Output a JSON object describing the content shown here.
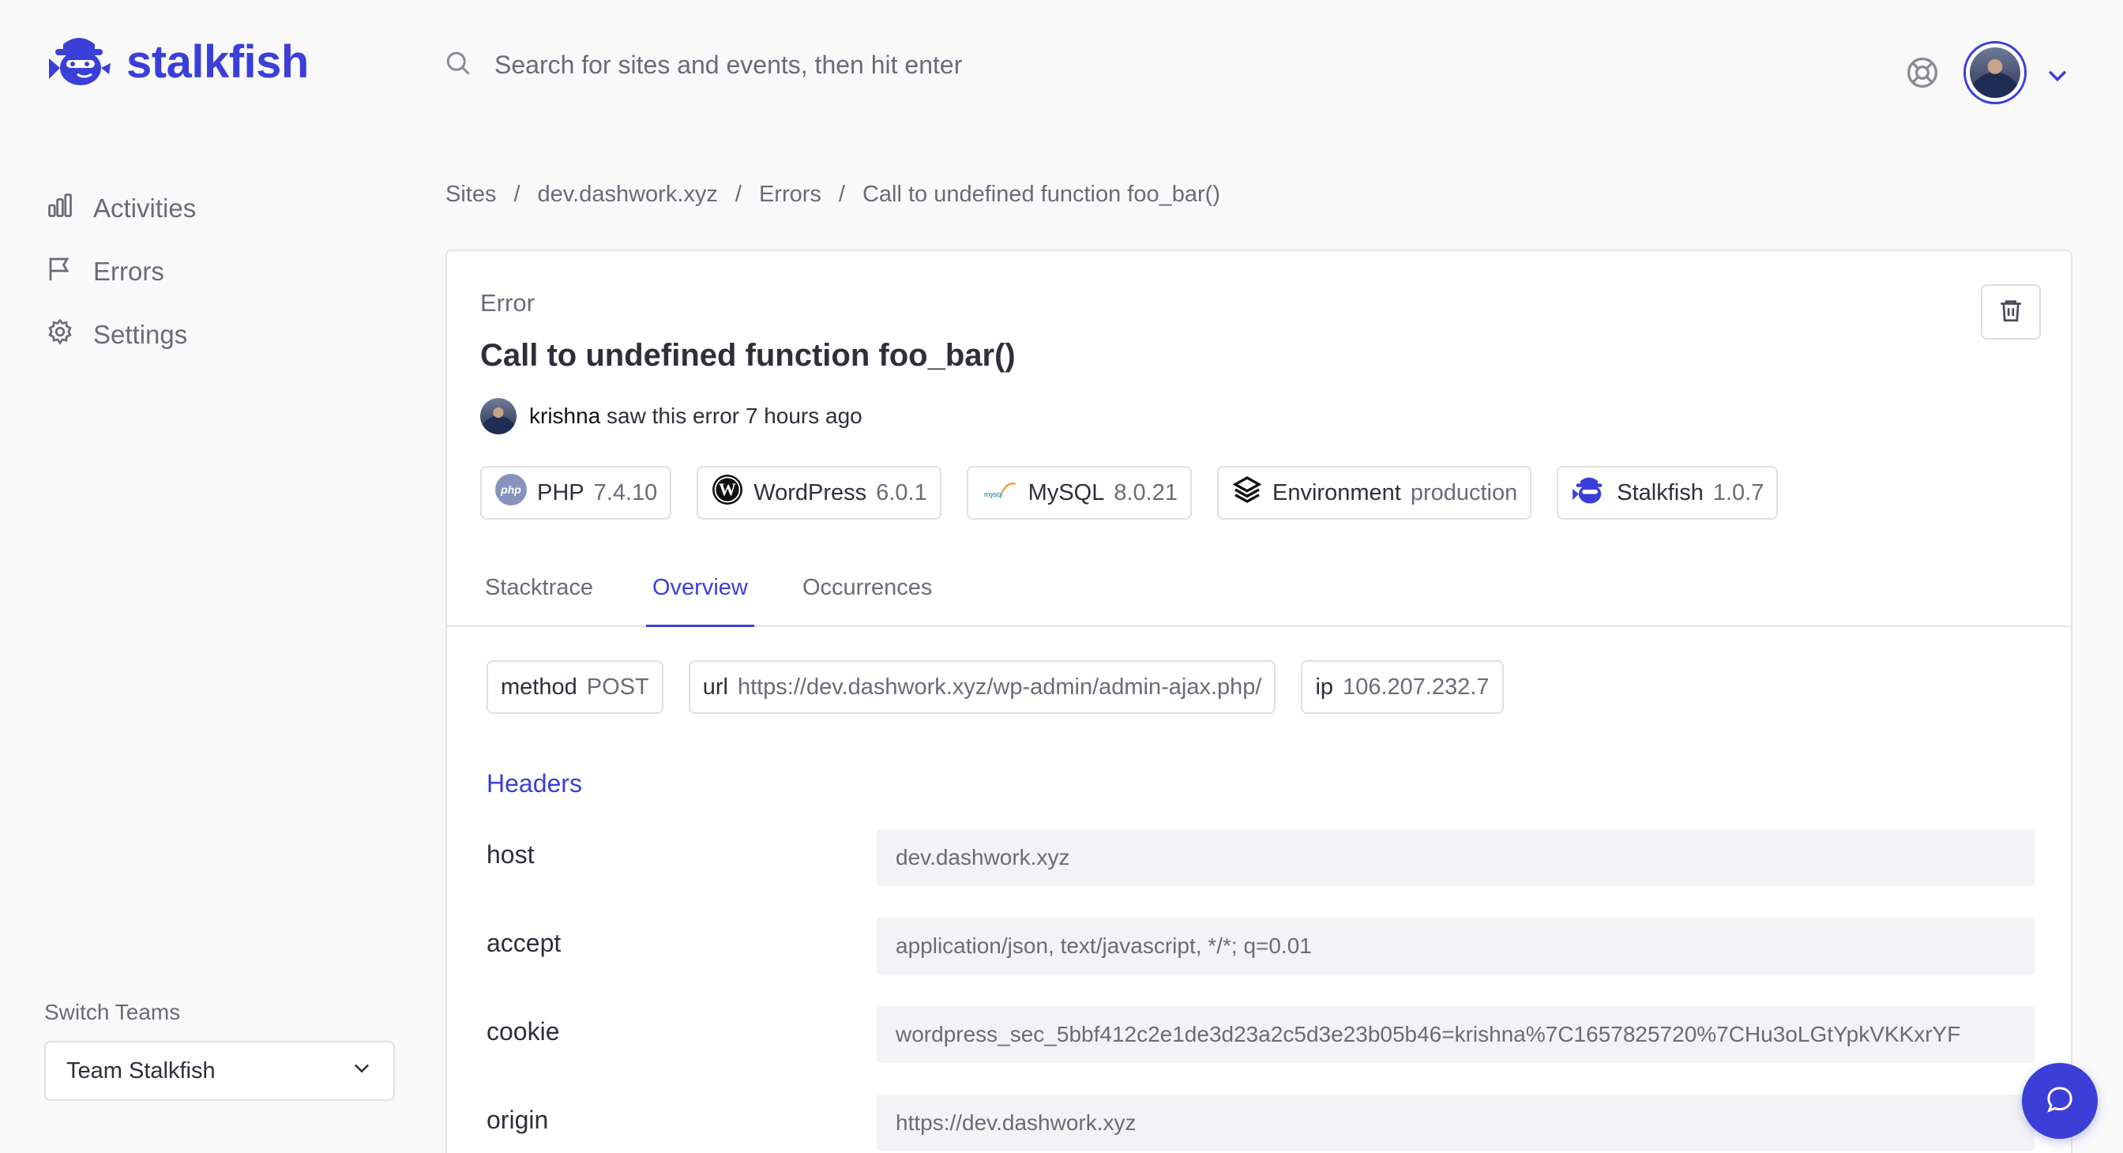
{
  "brand": {
    "name": "stalkfish",
    "accent": "#3b3fd8"
  },
  "search": {
    "placeholder": "Search for sites and events, then hit enter",
    "value": ""
  },
  "sidebar": {
    "items": [
      {
        "label": "Activities",
        "icon": "bar-chart-icon"
      },
      {
        "label": "Errors",
        "icon": "flag-icon"
      },
      {
        "label": "Settings",
        "icon": "gear-icon"
      }
    ],
    "switch_label": "Switch Teams",
    "team_selected": "Team Stalkfish"
  },
  "breadcrumb": [
    "Sites",
    "dev.dashwork.xyz",
    "Errors",
    "Call to undefined function foo_bar()"
  ],
  "breadcrumb_sep": "/",
  "error": {
    "eyebrow": "Error",
    "title": "Call to undefined function foo_bar()",
    "seen_user": "krishna",
    "seen_text": "saw this error 7 hours ago"
  },
  "badges": [
    {
      "name": "PHP",
      "value": "7.4.10",
      "icon": "php-icon"
    },
    {
      "name": "WordPress",
      "value": "6.0.1",
      "icon": "wordpress-icon"
    },
    {
      "name": "MySQL",
      "value": "8.0.21",
      "icon": "mysql-icon"
    },
    {
      "name": "Environment",
      "value": "production",
      "icon": "layers-icon"
    },
    {
      "name": "Stalkfish",
      "value": "1.0.7",
      "icon": "stalkfish-icon"
    }
  ],
  "tabs": [
    "Stacktrace",
    "Overview",
    "Occurrences"
  ],
  "active_tab": "Overview",
  "meta": [
    {
      "name": "method",
      "value": "POST"
    },
    {
      "name": "url",
      "value": "https://dev.dashwork.xyz/wp-admin/admin-ajax.php/"
    },
    {
      "name": "ip",
      "value": "106.207.232.7"
    }
  ],
  "headers": {
    "title": "Headers",
    "rows": [
      {
        "key": "host",
        "value": "dev.dashwork.xyz"
      },
      {
        "key": "accept",
        "value": "application/json, text/javascript, */*; q=0.01"
      },
      {
        "key": "cookie",
        "value": "wordpress_sec_5bbf412c2e1de3d23a2c5d3e23b05b46=krishna%7C1657825720%7CHu3oLGtYpkVKKxrYF"
      },
      {
        "key": "origin",
        "value": "https://dev.dashwork.xyz"
      }
    ]
  }
}
